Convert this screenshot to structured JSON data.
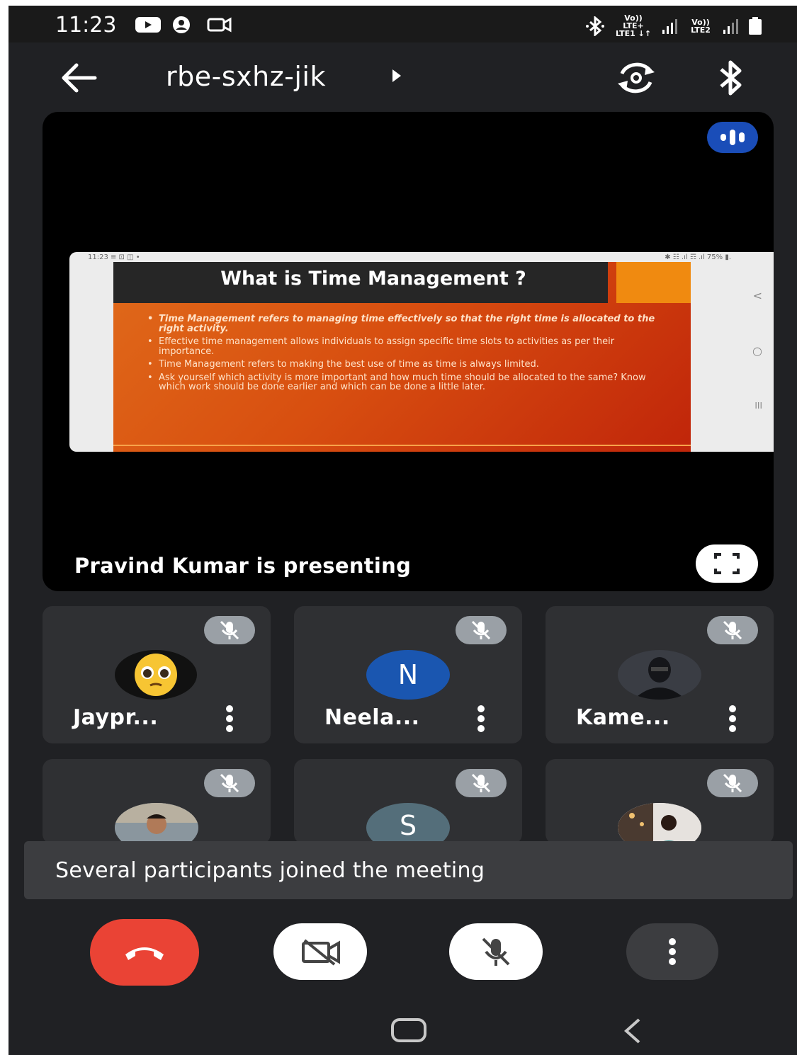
{
  "status_bar": {
    "time": "11:23",
    "sim1_label_top": "Vo)) LTE+",
    "sim1_label_bottom": "LTE1 ↓↑",
    "sim2_label_top": "Vo))",
    "sim2_label_bottom": "LTE2",
    "icons": [
      "youtube-icon",
      "account-icon",
      "screen-record-icon",
      "bluetooth-icon",
      "signal-icon",
      "battery-icon"
    ]
  },
  "header": {
    "meeting_code": "rbe-sxhz-jik",
    "icons": [
      "back-arrow-icon",
      "play-arrow-icon",
      "switch-camera-icon",
      "bluetooth-icon"
    ]
  },
  "presentation": {
    "screen_status_time": "11:23 ≡ ⊡ ◫ •",
    "screen_status_right": "✱ ☷ .ıl ☶ .ıl 75% ▮.",
    "slide_title": "What is Time Management ?",
    "slide_bullets": [
      "Time Management refers to managing time effectively so that the right time is allocated to the right activity.",
      "Effective time management allows individuals to assign specific time slots to activities as per their importance.",
      "Time Management refers to making the best use of time as time is always limited.",
      "Ask yourself which activity is more important and how much time should be allocated to the same? Know which work should be done earlier and which can be done a little later."
    ],
    "side_nav": [
      "<",
      "○",
      "III"
    ],
    "presenter_text": "Pravind Kumar is presenting"
  },
  "participants": [
    {
      "name": "Jaypr...",
      "avatar": "emoji-pleading-face",
      "muted": true
    },
    {
      "name": "Neela...",
      "avatar_letter": "N",
      "avatar_color": "#1a56b0",
      "muted": true
    },
    {
      "name": "Kame...",
      "avatar": "photo",
      "muted": true
    },
    {
      "name": "",
      "avatar": "photo",
      "muted": true
    },
    {
      "name": "",
      "avatar_letter": "S",
      "avatar_color": "#546e7a",
      "muted": true
    },
    {
      "name": "",
      "avatar": "photo",
      "muted": true
    }
  ],
  "toast": {
    "message": "Several participants joined the meeting"
  },
  "controls": [
    "end-call",
    "camera-off",
    "mic-off",
    "more-options"
  ],
  "colors": {
    "end_call": "#ea4335",
    "speaking_indicator": "#1a4db8",
    "background": "#202124"
  }
}
